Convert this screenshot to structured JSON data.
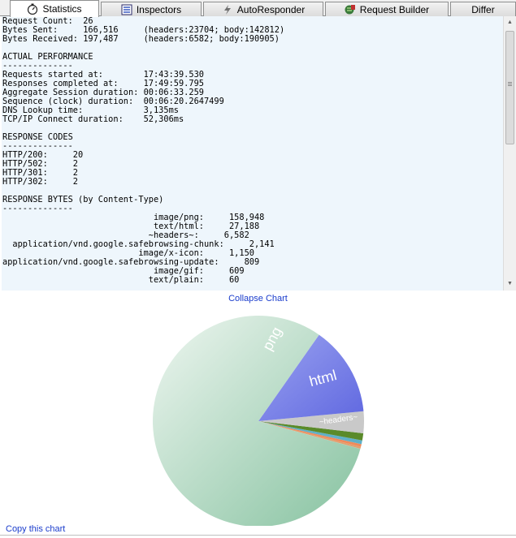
{
  "tabs": [
    {
      "label": "Statistics",
      "icon": "stopwatch-icon",
      "active": true
    },
    {
      "label": "Inspectors",
      "icon": "inspector-icon",
      "active": false
    },
    {
      "label": "AutoResponder",
      "icon": "lightning-icon",
      "active": false
    },
    {
      "label": "Request Builder",
      "icon": "builder-icon",
      "active": false
    },
    {
      "label": "Differ",
      "icon": "",
      "active": false
    }
  ],
  "stats": {
    "summary": [
      "Request Count:  26",
      "Bytes Sent:     166,516     (headers:23704; body:142812)",
      "Bytes Received: 197,487     (headers:6582; body:190905)"
    ],
    "performance_title": "ACTUAL PERFORMANCE",
    "performance_rule": "--------------",
    "performance": [
      "Requests started at:        17:43:39.530",
      "Responses completed at:     17:49:59.795",
      "Aggregate Session duration: 00:06:33.259",
      "Sequence (clock) duration:  00:06:20.2647499",
      "DNS Lookup time:            3,135ms",
      "TCP/IP Connect duration:    52,306ms"
    ],
    "codes_title": "RESPONSE CODES",
    "codes_rule": "--------------",
    "codes": [
      "HTTP/200:     20",
      "HTTP/502:     2",
      "HTTP/301:     2",
      "HTTP/302:     2"
    ],
    "bytes_title": "RESPONSE BYTES (by Content-Type)",
    "bytes_rule": "--------------",
    "bytes": [
      "                              image/png:     158,948",
      "                              text/html:     27,188",
      "                             ~headers~:     6,582",
      "  application/vnd.google.safebrowsing-chunk:     2,141",
      "                           image/x-icon:     1,150",
      "application/vnd.google.safebrowsing-update:     809",
      "                              image/gif:     609",
      "                             text/plain:     60"
    ]
  },
  "collapse_chart": "Collapse Chart",
  "copy_chart": "Copy this chart",
  "chart_data": {
    "type": "pie",
    "title": "",
    "labels": [
      "png",
      "html",
      "~headers~",
      "",
      "",
      "",
      "",
      ""
    ],
    "categories": [
      "image/png",
      "text/html",
      "~headers~",
      "application/vnd.google.safebrowsing-chunk",
      "image/x-icon",
      "application/vnd.google.safebrowsing-update",
      "image/gif",
      "text/plain"
    ],
    "values": [
      158948,
      27188,
      6582,
      2141,
      1150,
      809,
      609,
      60
    ],
    "colors": [
      "#8cc4a6",
      "#7b86e6",
      "#c9c9c9",
      "#5a8a2a",
      "#5fb0c8",
      "#f08a5a",
      "#e0a070",
      "#b0b0b0"
    ]
  }
}
